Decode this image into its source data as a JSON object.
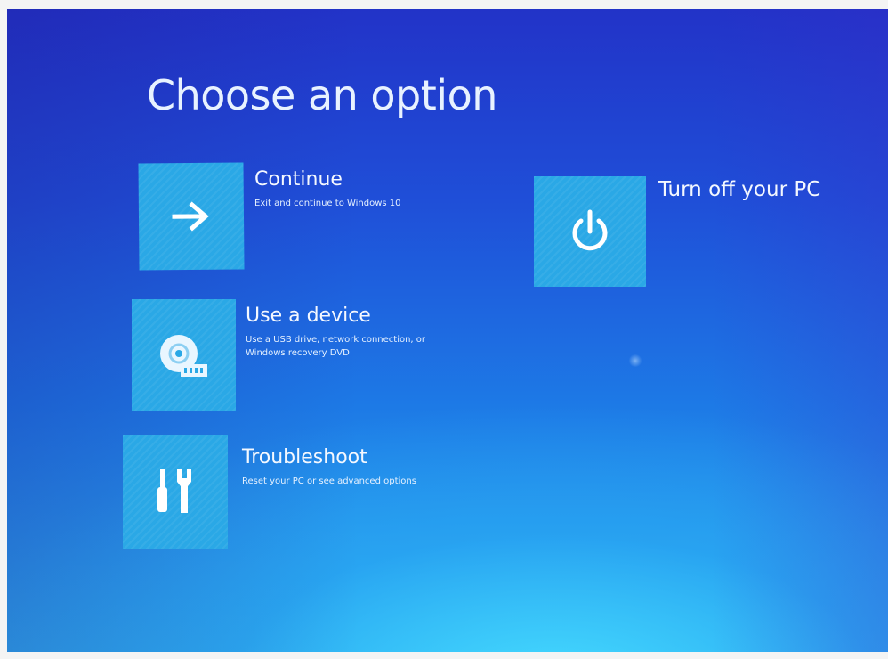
{
  "screen": {
    "title": "Choose an option"
  },
  "options": [
    {
      "id": "continue",
      "title": "Continue",
      "description": "Exit and continue to Windows 10",
      "icon": "arrow-right-icon"
    },
    {
      "id": "use-device",
      "title": "Use a device",
      "description": "Use a USB drive, network connection, or\nWindows recovery DVD",
      "icon": "disc-device-icon"
    },
    {
      "id": "troubleshoot",
      "title": "Troubleshoot",
      "description": "Reset your PC or see advanced options",
      "icon": "tools-icon"
    },
    {
      "id": "power",
      "title": "Turn off your PC",
      "description": "",
      "icon": "power-icon"
    }
  ],
  "colors": {
    "background_top": "#2233c8",
    "background_bottom": "#2fb0f0",
    "tile": "#2aa8e6",
    "text": "#ffffff"
  }
}
